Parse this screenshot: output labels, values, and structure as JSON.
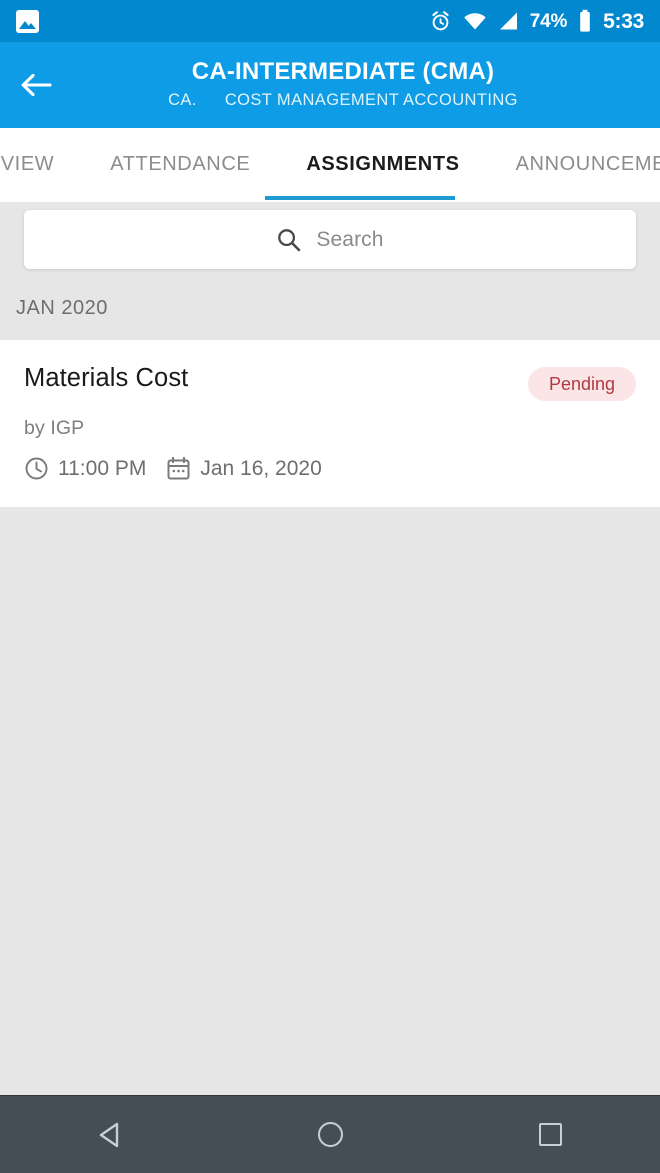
{
  "status_bar": {
    "notification_icon": "photo-icon",
    "alarm_icon": "alarm-clock-icon",
    "wifi_icon": "wifi-icon",
    "signal_icon": "cellular-signal-icon",
    "battery_percent": "74%",
    "battery_icon": "battery-icon",
    "time": "5:33",
    "background_color": "#0288cf"
  },
  "app_bar": {
    "back_icon": "back-arrow-icon",
    "title": "CA-INTERMEDIATE (CMA)",
    "subtitle_code": "CA.",
    "subtitle_name": "COST MANAGEMENT ACCOUNTING",
    "background_color": "#0d9ce5"
  },
  "tabs": {
    "items": [
      {
        "label": "OVERVIEW",
        "active": false
      },
      {
        "label": "ATTENDANCE",
        "active": false
      },
      {
        "label": "ASSIGNMENTS",
        "active": true
      },
      {
        "label": "ANNOUNCEMENTS",
        "active": false
      }
    ],
    "indicator_color": "#1e9bd0"
  },
  "search": {
    "icon": "search-icon",
    "placeholder": "Search",
    "value": ""
  },
  "assignments": {
    "month_header": "JAN 2020",
    "items": [
      {
        "title": "Materials Cost",
        "author": "by IGP",
        "time": "11:00 PM",
        "time_icon": "clock-icon",
        "date": "Jan 16, 2020",
        "date_icon": "calendar-icon",
        "status": "Pending",
        "status_bg": "#fbe5e6",
        "status_color": "#b03a43"
      }
    ]
  },
  "nav_bar": {
    "back_icon": "triangle-back-icon",
    "home_icon": "circle-home-icon",
    "recents_icon": "square-recents-icon",
    "background_color": "#454d55"
  }
}
